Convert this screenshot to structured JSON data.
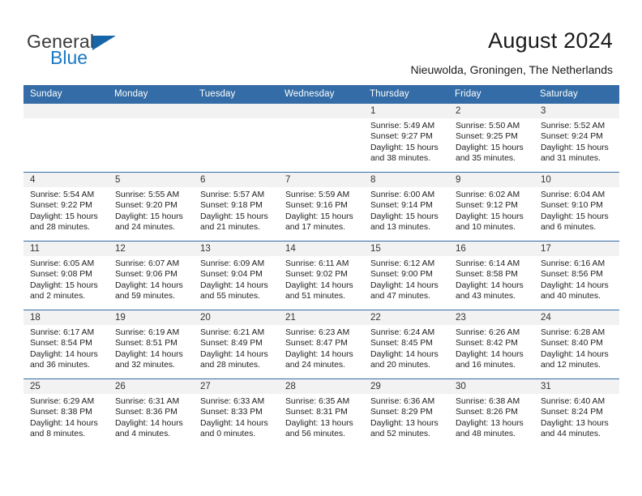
{
  "brand": {
    "name_part1": "General",
    "name_part2": "Blue",
    "logo_icon": "triangle-logo-icon",
    "accent_color": "#1a79c4"
  },
  "header": {
    "title": "August 2024",
    "subtitle": "Nieuwolda, Groningen, The Netherlands"
  },
  "calendar": {
    "header_bg": "#336ca6",
    "daynum_bg": "#f2f2f2",
    "weekday_headers": [
      "Sunday",
      "Monday",
      "Tuesday",
      "Wednesday",
      "Thursday",
      "Friday",
      "Saturday"
    ],
    "weeks": [
      [
        {
          "day": "",
          "sunrise": "",
          "sunset": "",
          "daylight_line1": "",
          "daylight_line2": ""
        },
        {
          "day": "",
          "sunrise": "",
          "sunset": "",
          "daylight_line1": "",
          "daylight_line2": ""
        },
        {
          "day": "",
          "sunrise": "",
          "sunset": "",
          "daylight_line1": "",
          "daylight_line2": ""
        },
        {
          "day": "",
          "sunrise": "",
          "sunset": "",
          "daylight_line1": "",
          "daylight_line2": ""
        },
        {
          "day": "1",
          "sunrise": "Sunrise: 5:49 AM",
          "sunset": "Sunset: 9:27 PM",
          "daylight_line1": "Daylight: 15 hours",
          "daylight_line2": "and 38 minutes."
        },
        {
          "day": "2",
          "sunrise": "Sunrise: 5:50 AM",
          "sunset": "Sunset: 9:25 PM",
          "daylight_line1": "Daylight: 15 hours",
          "daylight_line2": "and 35 minutes."
        },
        {
          "day": "3",
          "sunrise": "Sunrise: 5:52 AM",
          "sunset": "Sunset: 9:24 PM",
          "daylight_line1": "Daylight: 15 hours",
          "daylight_line2": "and 31 minutes."
        }
      ],
      [
        {
          "day": "4",
          "sunrise": "Sunrise: 5:54 AM",
          "sunset": "Sunset: 9:22 PM",
          "daylight_line1": "Daylight: 15 hours",
          "daylight_line2": "and 28 minutes."
        },
        {
          "day": "5",
          "sunrise": "Sunrise: 5:55 AM",
          "sunset": "Sunset: 9:20 PM",
          "daylight_line1": "Daylight: 15 hours",
          "daylight_line2": "and 24 minutes."
        },
        {
          "day": "6",
          "sunrise": "Sunrise: 5:57 AM",
          "sunset": "Sunset: 9:18 PM",
          "daylight_line1": "Daylight: 15 hours",
          "daylight_line2": "and 21 minutes."
        },
        {
          "day": "7",
          "sunrise": "Sunrise: 5:59 AM",
          "sunset": "Sunset: 9:16 PM",
          "daylight_line1": "Daylight: 15 hours",
          "daylight_line2": "and 17 minutes."
        },
        {
          "day": "8",
          "sunrise": "Sunrise: 6:00 AM",
          "sunset": "Sunset: 9:14 PM",
          "daylight_line1": "Daylight: 15 hours",
          "daylight_line2": "and 13 minutes."
        },
        {
          "day": "9",
          "sunrise": "Sunrise: 6:02 AM",
          "sunset": "Sunset: 9:12 PM",
          "daylight_line1": "Daylight: 15 hours",
          "daylight_line2": "and 10 minutes."
        },
        {
          "day": "10",
          "sunrise": "Sunrise: 6:04 AM",
          "sunset": "Sunset: 9:10 PM",
          "daylight_line1": "Daylight: 15 hours",
          "daylight_line2": "and 6 minutes."
        }
      ],
      [
        {
          "day": "11",
          "sunrise": "Sunrise: 6:05 AM",
          "sunset": "Sunset: 9:08 PM",
          "daylight_line1": "Daylight: 15 hours",
          "daylight_line2": "and 2 minutes."
        },
        {
          "day": "12",
          "sunrise": "Sunrise: 6:07 AM",
          "sunset": "Sunset: 9:06 PM",
          "daylight_line1": "Daylight: 14 hours",
          "daylight_line2": "and 59 minutes."
        },
        {
          "day": "13",
          "sunrise": "Sunrise: 6:09 AM",
          "sunset": "Sunset: 9:04 PM",
          "daylight_line1": "Daylight: 14 hours",
          "daylight_line2": "and 55 minutes."
        },
        {
          "day": "14",
          "sunrise": "Sunrise: 6:11 AM",
          "sunset": "Sunset: 9:02 PM",
          "daylight_line1": "Daylight: 14 hours",
          "daylight_line2": "and 51 minutes."
        },
        {
          "day": "15",
          "sunrise": "Sunrise: 6:12 AM",
          "sunset": "Sunset: 9:00 PM",
          "daylight_line1": "Daylight: 14 hours",
          "daylight_line2": "and 47 minutes."
        },
        {
          "day": "16",
          "sunrise": "Sunrise: 6:14 AM",
          "sunset": "Sunset: 8:58 PM",
          "daylight_line1": "Daylight: 14 hours",
          "daylight_line2": "and 43 minutes."
        },
        {
          "day": "17",
          "sunrise": "Sunrise: 6:16 AM",
          "sunset": "Sunset: 8:56 PM",
          "daylight_line1": "Daylight: 14 hours",
          "daylight_line2": "and 40 minutes."
        }
      ],
      [
        {
          "day": "18",
          "sunrise": "Sunrise: 6:17 AM",
          "sunset": "Sunset: 8:54 PM",
          "daylight_line1": "Daylight: 14 hours",
          "daylight_line2": "and 36 minutes."
        },
        {
          "day": "19",
          "sunrise": "Sunrise: 6:19 AM",
          "sunset": "Sunset: 8:51 PM",
          "daylight_line1": "Daylight: 14 hours",
          "daylight_line2": "and 32 minutes."
        },
        {
          "day": "20",
          "sunrise": "Sunrise: 6:21 AM",
          "sunset": "Sunset: 8:49 PM",
          "daylight_line1": "Daylight: 14 hours",
          "daylight_line2": "and 28 minutes."
        },
        {
          "day": "21",
          "sunrise": "Sunrise: 6:23 AM",
          "sunset": "Sunset: 8:47 PM",
          "daylight_line1": "Daylight: 14 hours",
          "daylight_line2": "and 24 minutes."
        },
        {
          "day": "22",
          "sunrise": "Sunrise: 6:24 AM",
          "sunset": "Sunset: 8:45 PM",
          "daylight_line1": "Daylight: 14 hours",
          "daylight_line2": "and 20 minutes."
        },
        {
          "day": "23",
          "sunrise": "Sunrise: 6:26 AM",
          "sunset": "Sunset: 8:42 PM",
          "daylight_line1": "Daylight: 14 hours",
          "daylight_line2": "and 16 minutes."
        },
        {
          "day": "24",
          "sunrise": "Sunrise: 6:28 AM",
          "sunset": "Sunset: 8:40 PM",
          "daylight_line1": "Daylight: 14 hours",
          "daylight_line2": "and 12 minutes."
        }
      ],
      [
        {
          "day": "25",
          "sunrise": "Sunrise: 6:29 AM",
          "sunset": "Sunset: 8:38 PM",
          "daylight_line1": "Daylight: 14 hours",
          "daylight_line2": "and 8 minutes."
        },
        {
          "day": "26",
          "sunrise": "Sunrise: 6:31 AM",
          "sunset": "Sunset: 8:36 PM",
          "daylight_line1": "Daylight: 14 hours",
          "daylight_line2": "and 4 minutes."
        },
        {
          "day": "27",
          "sunrise": "Sunrise: 6:33 AM",
          "sunset": "Sunset: 8:33 PM",
          "daylight_line1": "Daylight: 14 hours",
          "daylight_line2": "and 0 minutes."
        },
        {
          "day": "28",
          "sunrise": "Sunrise: 6:35 AM",
          "sunset": "Sunset: 8:31 PM",
          "daylight_line1": "Daylight: 13 hours",
          "daylight_line2": "and 56 minutes."
        },
        {
          "day": "29",
          "sunrise": "Sunrise: 6:36 AM",
          "sunset": "Sunset: 8:29 PM",
          "daylight_line1": "Daylight: 13 hours",
          "daylight_line2": "and 52 minutes."
        },
        {
          "day": "30",
          "sunrise": "Sunrise: 6:38 AM",
          "sunset": "Sunset: 8:26 PM",
          "daylight_line1": "Daylight: 13 hours",
          "daylight_line2": "and 48 minutes."
        },
        {
          "day": "31",
          "sunrise": "Sunrise: 6:40 AM",
          "sunset": "Sunset: 8:24 PM",
          "daylight_line1": "Daylight: 13 hours",
          "daylight_line2": "and 44 minutes."
        }
      ]
    ]
  }
}
